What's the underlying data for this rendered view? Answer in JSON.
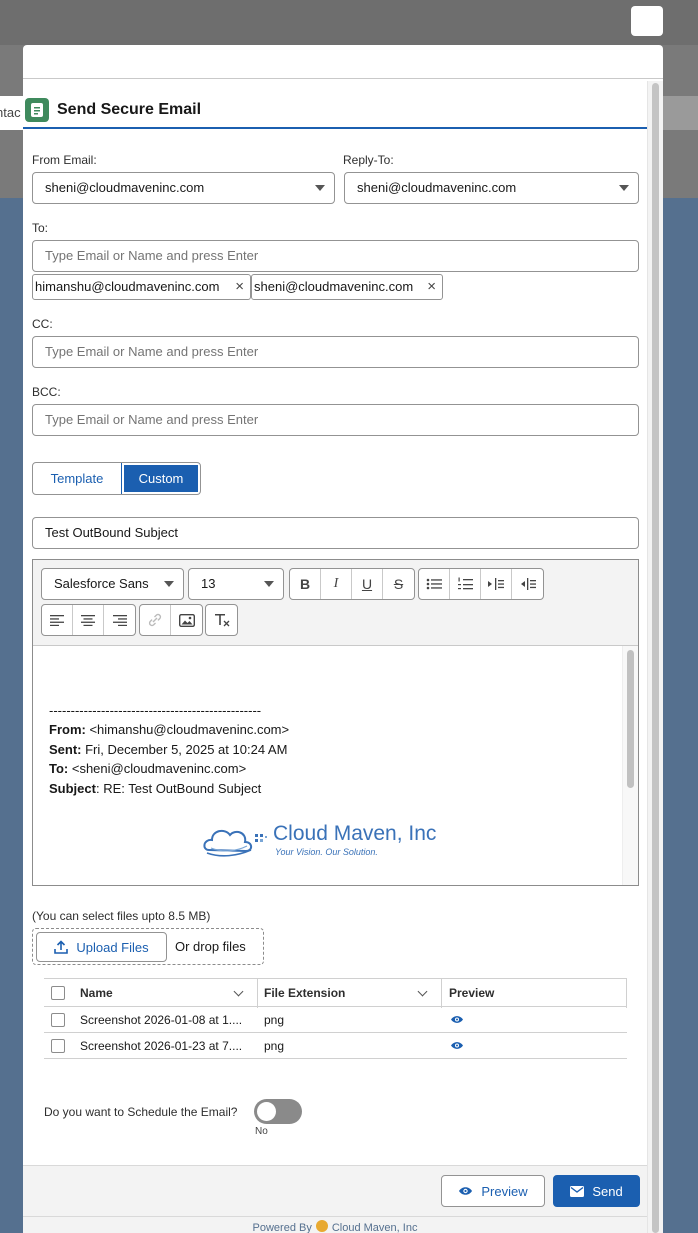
{
  "background": {
    "partial_tab_text": "ntac"
  },
  "modal": {
    "title": "Send Secure Email",
    "from": {
      "label": "From Email:",
      "value": "sheni@cloudmaveninc.com"
    },
    "reply_to": {
      "label": "Reply-To:",
      "value": "sheni@cloudmaveninc.com"
    },
    "to": {
      "label": "To:",
      "placeholder": "Type Email or Name and press Enter",
      "recipients": [
        "himanshu@cloudmaveninc.com",
        "sheni@cloudmaveninc.com"
      ],
      "remove_glyph": "×"
    },
    "cc": {
      "label": "CC:",
      "placeholder": "Type Email or Name and press Enter"
    },
    "bcc": {
      "label": "BCC:",
      "placeholder": "Type Email or Name and press Enter"
    },
    "mode_tabs": {
      "template": "Template",
      "custom": "Custom",
      "selected": "Custom"
    },
    "subject": "Test OutBound Subject",
    "editor": {
      "font_family": "Salesforce Sans",
      "font_size": "13",
      "body": {
        "separator": "-------------------------------------------------",
        "from_label": "From:",
        "from_value": " <himanshu@cloudmaveninc.com>",
        "sent_label": "Sent:",
        "sent_value": " Fri, December 5, 2025 at 10:24 AM",
        "to_label": "To:",
        "to_value": " <sheni@cloudmaveninc.com>",
        "subject_label": "Subject",
        "subject_value": ": RE: Test OutBound Subject",
        "logo_name": "Cloud Maven, Inc",
        "logo_tagline": "Your Vision. Our Solution."
      }
    },
    "attachments": {
      "note": "(You can select files upto 8.5 MB)",
      "upload_label": "Upload Files",
      "drop_label": "Or drop files",
      "columns": {
        "name": "Name",
        "extension": "File Extension",
        "preview": "Preview"
      },
      "rows": [
        {
          "name": "Screenshot 2026-01-08 at 1....",
          "extension": "png"
        },
        {
          "name": "Screenshot 2026-01-23 at 7....",
          "extension": "png"
        }
      ]
    },
    "schedule": {
      "question": "Do you want to Schedule the Email?",
      "state": "No"
    },
    "footer": {
      "preview": "Preview",
      "send": "Send",
      "powered_by": "Powered By",
      "powered_brand": "Cloud Maven, Inc"
    },
    "colors": {
      "brand_blue": "#1b5fb0",
      "title_icon_green": "#3f8a5d"
    }
  }
}
